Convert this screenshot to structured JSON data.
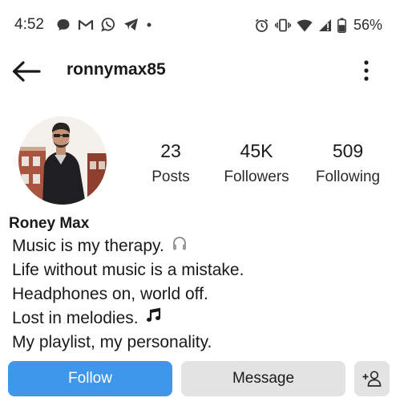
{
  "status_bar": {
    "time": "4:52",
    "battery": "56%",
    "left_icons": [
      "chat-bubble-icon",
      "gmail-icon",
      "whatsapp-icon",
      "telegram-icon",
      "dot-icon"
    ],
    "right_icons": [
      "alarm-icon",
      "vibrate-icon",
      "wifi-icon",
      "signal-icon",
      "battery-icon"
    ]
  },
  "header": {
    "username": "ronnymax85",
    "back_icon": "arrow-left-icon",
    "more_icon": "more-vertical-icon"
  },
  "profile": {
    "posts_count": "23",
    "posts_label": "Posts",
    "followers_count": "45K",
    "followers_label": "Followers",
    "following_count": "509",
    "following_label": "Following",
    "display_name": "Roney Max",
    "bio": [
      {
        "text": "Music is my therapy.",
        "emoji": "headphones-icon"
      },
      {
        "text": "Life without music is a mistake."
      },
      {
        "text": "Headphones on, world off."
      },
      {
        "text": "Lost in melodies.",
        "emoji": "music-notes-icon"
      },
      {
        "text": "My playlist, my personality."
      }
    ]
  },
  "actions": {
    "follow_label": "Follow",
    "message_label": "Message",
    "suggest_icon": "add-person-icon"
  },
  "colors": {
    "follow_button": "#3f97ec",
    "secondary_button": "#e3e3e3",
    "text": "#1a1a1a"
  }
}
